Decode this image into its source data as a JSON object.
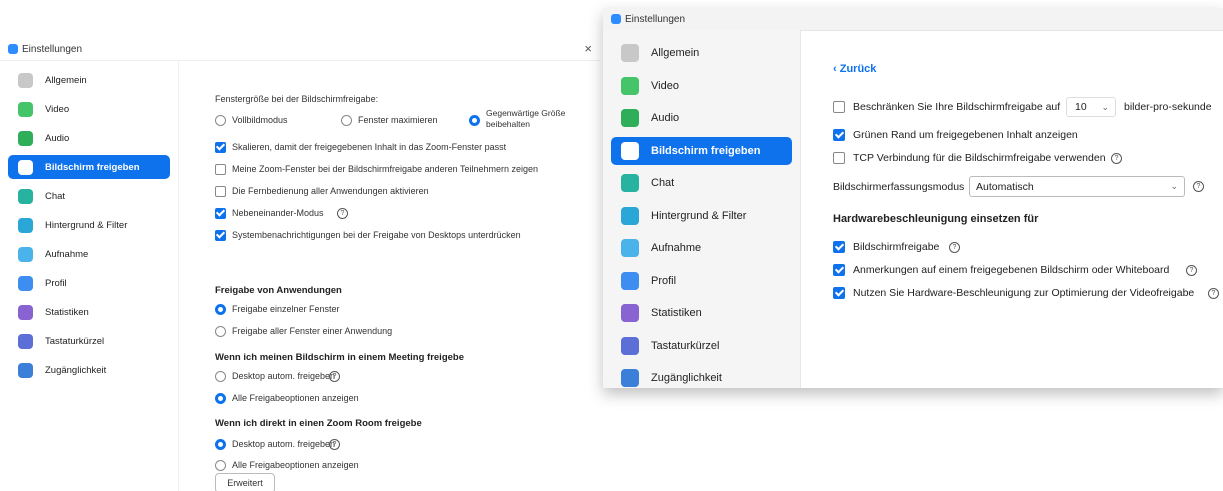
{
  "colors": {
    "accent": "#0e72ed",
    "brand": "#2d8cff"
  },
  "win1": {
    "title": "Einstellungen",
    "close_icon": "×",
    "nav": [
      {
        "label": "Allgemein",
        "icon": "gear-icon",
        "color": "#c8c8c8"
      },
      {
        "label": "Video",
        "icon": "video-icon",
        "color": "#45c46a"
      },
      {
        "label": "Audio",
        "icon": "headphones-icon",
        "color": "#2fae5a"
      },
      {
        "label": "Bildschirm freigeben",
        "icon": "share-screen-icon",
        "color": "#ffffff"
      },
      {
        "label": "Chat",
        "icon": "chat-icon",
        "color": "#27b3a0"
      },
      {
        "label": "Hintergrund & Filter",
        "icon": "background-icon",
        "color": "#2aa7d6"
      },
      {
        "label": "Aufnahme",
        "icon": "record-icon",
        "color": "#4ab3ea"
      },
      {
        "label": "Profil",
        "icon": "profile-icon",
        "color": "#3d8ef0"
      },
      {
        "label": "Statistiken",
        "icon": "statistics-icon",
        "color": "#8a63d2"
      },
      {
        "label": "Tastaturkürzel",
        "icon": "keyboard-icon",
        "color": "#5b6fd6"
      },
      {
        "label": "Zugänglichkeit",
        "icon": "accessibility-icon",
        "color": "#3b7fd9"
      }
    ],
    "window_size": {
      "heading": "Fenstergröße bei der Bildschirmfreigabe:",
      "fullscreen": "Vollbildmodus",
      "maximize": "Fenster maximieren",
      "keep_line1": "Gegenwärtige Größe",
      "keep_line2": "beibehalten"
    },
    "options": {
      "scale": "Skalieren, damit der freigegebenen Inhalt in das Zoom-Fenster passt",
      "show_zoom": "Meine Zoom-Fenster bei der Bildschirmfreigabe anderen Teilnehmern zeigen",
      "remote": "Die Fernbedienung aller Anwendungen aktivieren",
      "side_by_side": "Nebeneinander-Modus",
      "suppress": "Systembenachrichtigungen bei der Freigabe von Desktops unterdrücken"
    },
    "app_share": {
      "heading": "Freigabe von Anwendungen",
      "single": "Freigabe einzelner Fenster",
      "all": "Freigabe aller Fenster einer Anwendung"
    },
    "meeting": {
      "heading": "Wenn ich meinen Bildschirm in einem Meeting freigebe",
      "desktop": "Desktop autom. freigeben",
      "show_all": "Alle Freigabeoptionen anzeigen"
    },
    "zoom_room": {
      "heading": "Wenn ich direkt in einen Zoom Room freigebe",
      "desktop": "Desktop autom. freigeben",
      "show_all": "Alle Freigabeoptionen anzeigen"
    },
    "advanced_button": "Erweitert"
  },
  "win2": {
    "title": "Einstellungen",
    "nav": [
      {
        "label": "Allgemein",
        "icon": "gear-icon",
        "color": "#c8c8c8"
      },
      {
        "label": "Video",
        "icon": "video-icon",
        "color": "#45c46a"
      },
      {
        "label": "Audio",
        "icon": "headphones-icon",
        "color": "#2fae5a"
      },
      {
        "label": "Bildschirm freigeben",
        "icon": "share-screen-icon",
        "color": "#ffffff"
      },
      {
        "label": "Chat",
        "icon": "chat-icon",
        "color": "#27b3a0"
      },
      {
        "label": "Hintergrund & Filter",
        "icon": "background-icon",
        "color": "#2aa7d6"
      },
      {
        "label": "Aufnahme",
        "icon": "record-icon",
        "color": "#4ab3ea"
      },
      {
        "label": "Profil",
        "icon": "profile-icon",
        "color": "#3d8ef0"
      },
      {
        "label": "Statistiken",
        "icon": "statistics-icon",
        "color": "#8a63d2"
      },
      {
        "label": "Tastaturkürzel",
        "icon": "keyboard-icon",
        "color": "#5b6fd6"
      },
      {
        "label": "Zugänglichkeit",
        "icon": "accessibility-icon",
        "color": "#3b7fd9"
      }
    ],
    "back_link": "‹ Zurück",
    "limit_label": "Beschränken Sie Ihre Bildschirmfreigabe auf",
    "fps_value": "10",
    "fps_unit": "bilder-pro-sekunde",
    "green_border": "Grünen Rand um freigegebenen Inhalt anzeigen",
    "tcp": "TCP Verbindung für die Bildschirmfreigabe verwenden",
    "capture_label": "Bildschirmerfassungsmodus",
    "capture_value": "Automatisch",
    "hw_heading": "Hardwarebeschleunigung einsetzen für",
    "hw_share": "Bildschirmfreigabe",
    "hw_annot": "Anmerkungen auf einem freigegebenen Bildschirm oder Whiteboard",
    "hw_video": "Nutzen Sie Hardware-Beschleunigung zur Optimierung der Videofreigabe",
    "help_icon": "?",
    "chevron": "⌄"
  }
}
